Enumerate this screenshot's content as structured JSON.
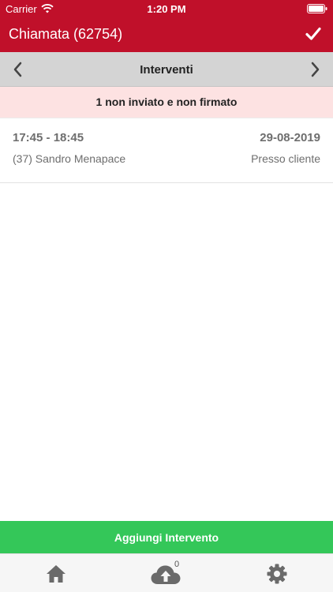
{
  "status_bar": {
    "carrier": "Carrier",
    "time": "1:20 PM"
  },
  "header": {
    "title": "Chiamata (62754)",
    "confirm_icon": "checkmark-icon"
  },
  "section": {
    "label": "Interventi",
    "prev_icon": "chevron-left-icon",
    "next_icon": "chevron-right-icon"
  },
  "warning": {
    "text": "1 non inviato e non firmato"
  },
  "interventions": [
    {
      "time_range": "17:45 - 18:45",
      "date": "29-08-2019",
      "technician": "(37) Sandro Menapace",
      "location": "Presso cliente"
    }
  ],
  "actions": {
    "add_label": "Aggiungi Intervento"
  },
  "tab_bar": {
    "home_icon": "home-icon",
    "sync_icon": "cloud-upload-icon",
    "sync_count": "0",
    "settings_icon": "gear-icon"
  },
  "colors": {
    "header_bg": "#c0102a",
    "section_bg": "#d4d4d4",
    "warning_bg": "#fde2e2",
    "add_button_bg": "#34c759",
    "text_gray": "#6e6e6e",
    "icon_gray": "#6a6a6a"
  }
}
